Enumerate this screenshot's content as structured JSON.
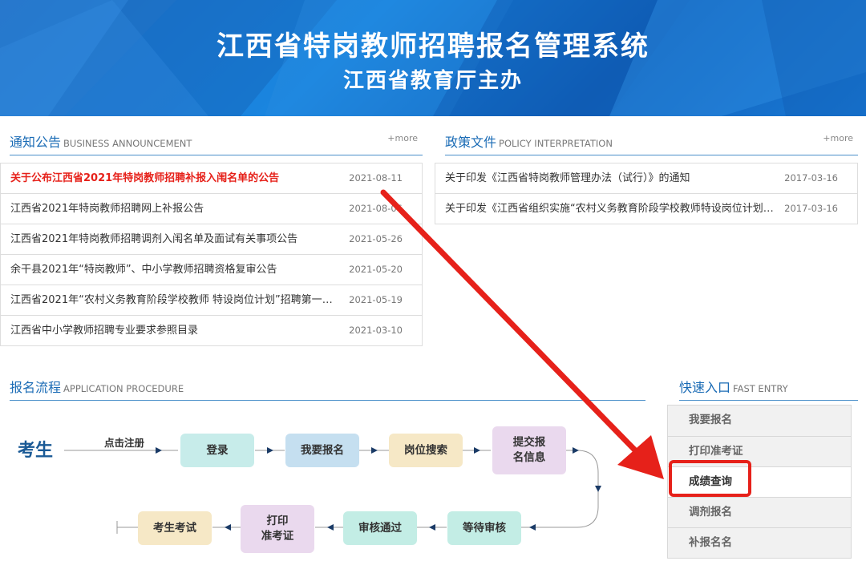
{
  "banner": {
    "title": "江西省特岗教师招聘报名管理系统",
    "subtitle": "江西省教育厅主办"
  },
  "announcement": {
    "title_cn": "通知公告",
    "title_en": "BUSINESS ANNOUNCEMENT",
    "more": "+more",
    "items": [
      {
        "title": "关于公布江西省2021年特岗教师招聘补报入闱名单的公告",
        "date": "2021-08-11"
      },
      {
        "title": "江西省2021年特岗教师招聘网上补报公告",
        "date": "2021-08-06"
      },
      {
        "title": "江西省2021年特岗教师招聘调剂入闱名单及面试有关事项公告",
        "date": "2021-05-26"
      },
      {
        "title": "余干县2021年“特岗教师”、中小学教师招聘资格复审公告",
        "date": "2021-05-20"
      },
      {
        "title": "江西省2021年“农村义务教育阶段学校教师 特设岗位计划”招聘第一批…",
        "date": "2021-05-19"
      },
      {
        "title": "江西省中小学教师招聘专业要求参照目录",
        "date": "2021-03-10"
      }
    ]
  },
  "policy": {
    "title_cn": "政策文件",
    "title_en": "POLICY INTERPRETATION",
    "more": "+more",
    "items": [
      {
        "title": "关于印发《江西省特岗教师管理办法（试行）》的通知",
        "date": "2017-03-16"
      },
      {
        "title": "关于印发《江西省组织实施“农村义务教育阶段学校教师特设岗位计划”…",
        "date": "2017-03-16"
      }
    ]
  },
  "procedure": {
    "title_cn": "报名流程",
    "title_en": "APPLICATION PROCEDURE",
    "examinee": "考生",
    "register": "点击注册",
    "steps": {
      "login": "登录",
      "apply": "我要报名",
      "search": "岗位搜索",
      "submit_1": "提交报",
      "submit_2": "名信息",
      "wait": "等待审核",
      "pass": "审核通过",
      "print_1": "打印",
      "print_2": "准考证",
      "exam": "考生考试"
    }
  },
  "fast_entry": {
    "title_cn": "快速入口",
    "title_en": "FAST ENTRY",
    "items": [
      "我要报名",
      "打印准考证",
      "成绩查询",
      "调剂报名",
      "补报名名"
    ]
  },
  "colors": {
    "accent": "#1a6bb5",
    "highlight_red": "#e6211a",
    "banner_blue": "#1a86e0"
  }
}
